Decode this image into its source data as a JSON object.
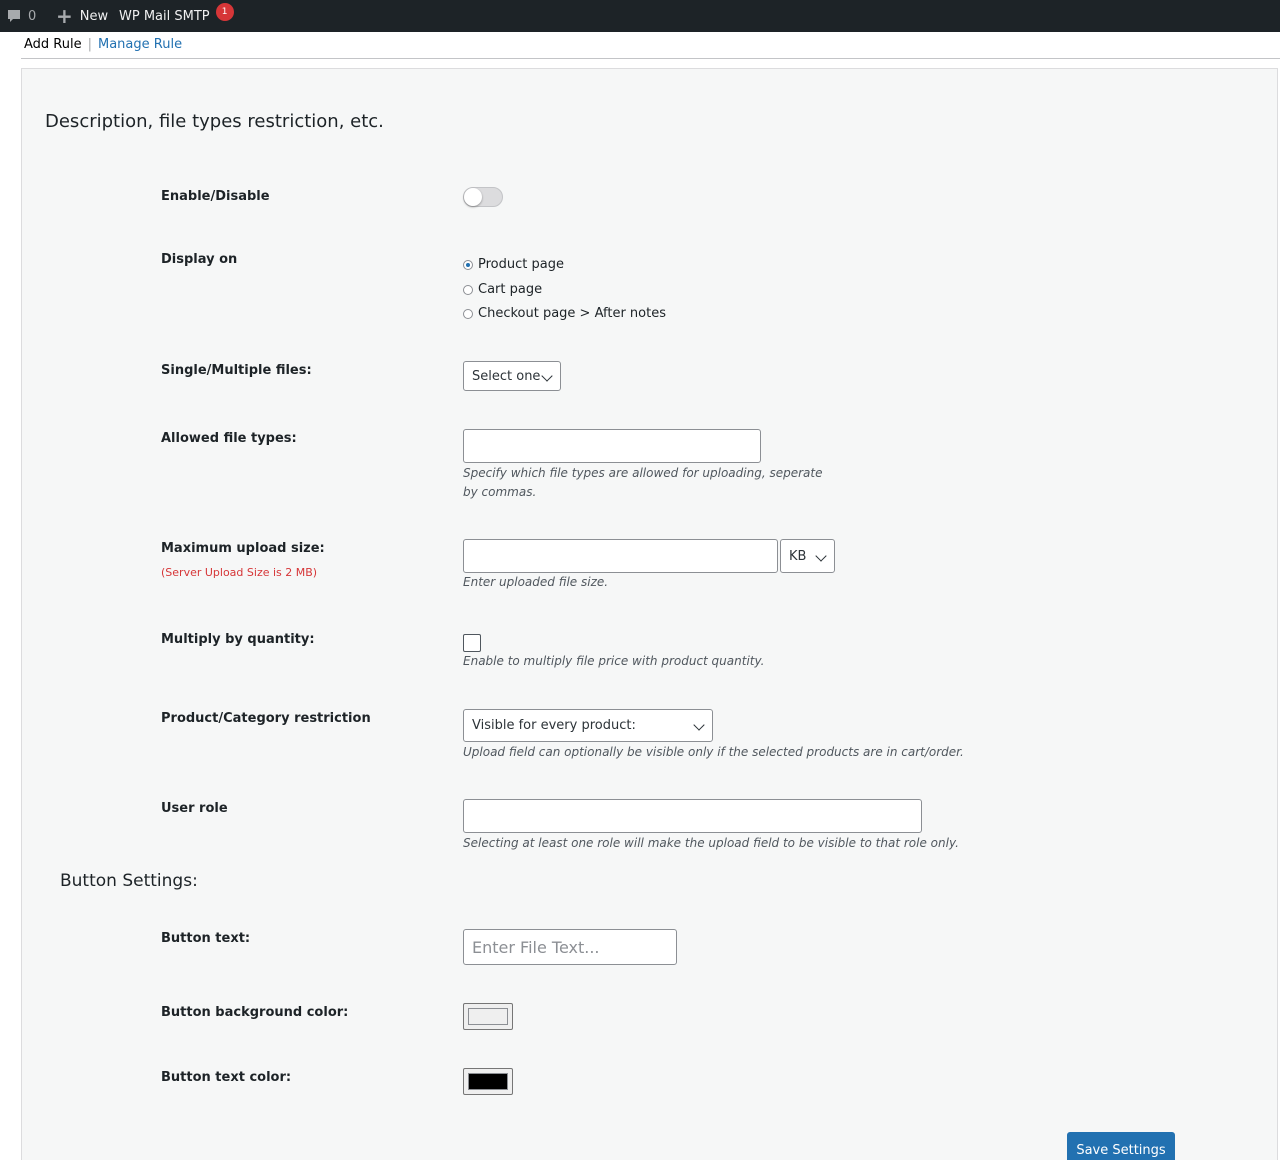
{
  "adminbar": {
    "comments_count": "0",
    "new_label": "New",
    "smtp_label": "WP Mail SMTP",
    "smtp_badge": "1"
  },
  "subnav": {
    "add_rule": "Add Rule",
    "separator": "|",
    "manage_rule": "Manage Rule"
  },
  "section": {
    "title": "Description, file types restriction, etc."
  },
  "fields": {
    "enable": {
      "label": "Enable/Disable",
      "enabled": false
    },
    "display_on": {
      "label": "Display on",
      "options": [
        "Product page",
        "Cart page",
        "Checkout page > After notes"
      ],
      "selected": "Product page"
    },
    "single_multiple": {
      "label": "Single/Multiple files:",
      "value": "Select one"
    },
    "allowed_types": {
      "label": "Allowed file types:",
      "value": "",
      "description": "Specify which file types are allowed for uploading, seperate by commas."
    },
    "max_upload": {
      "label": "Maximum upload size:",
      "note": "(Server Upload Size is 2 MB)",
      "value": "",
      "unit": "KB",
      "description": "Enter uploaded file size."
    },
    "multiply": {
      "label": "Multiply by quantity:",
      "checked": false,
      "description": "Enable to multiply file price with product quantity."
    },
    "restriction": {
      "label": "Product/Category restriction",
      "value": "Visible for every product:",
      "description": "Upload field can optionally be visible only if the selected products are in cart/order."
    },
    "user_role": {
      "label": "User role",
      "value": "",
      "description": "Selecting at least one role will make the upload field to be visible to that role only."
    }
  },
  "button_settings": {
    "title": "Button Settings:",
    "button_text": {
      "label": "Button text:",
      "placeholder": "Enter File Text..."
    },
    "bg_color": {
      "label": "Button background color:",
      "color": "#efefef"
    },
    "text_color": {
      "label": "Button text color:",
      "color": "#000000"
    }
  },
  "save_label": "Save Settings",
  "colors": {
    "accent": "#2271b1",
    "adminbar": "#1d2327",
    "danger": "#d63638"
  }
}
